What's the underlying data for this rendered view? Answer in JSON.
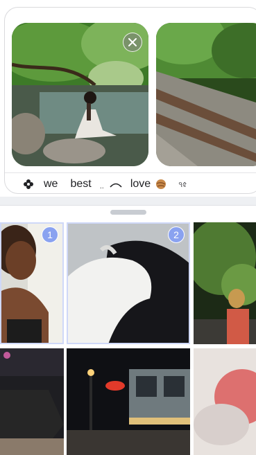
{
  "composer": {
    "attachments": [
      {
        "name": "meditating-by-river",
        "icon": "photo"
      },
      {
        "name": "railway-tracks",
        "icon": "photo"
      }
    ],
    "remove_icon": "close-icon",
    "suggestions": {
      "flower_icon": "flower-icon",
      "word_1": "we",
      "word_2": "best",
      "dots": "..",
      "arc_icon": "arc-icon",
      "word_3": "love",
      "emoji_icon": "planet-emoji-icon",
      "glyph": "ঀ৫"
    }
  },
  "picker": {
    "handle_icon": "drag-handle",
    "photos": [
      {
        "name": "selfie",
        "selected": true,
        "order": "1"
      },
      {
        "name": "horses",
        "selected": true,
        "order": "2"
      },
      {
        "name": "woman-in-trees",
        "selected": false
      },
      {
        "name": "night-street",
        "selected": false
      },
      {
        "name": "neon-sign-truck",
        "selected": false
      },
      {
        "name": "red-blur",
        "selected": false
      }
    ]
  },
  "colors": {
    "accent": "#8aa2f0",
    "card_border": "#d9d9dc",
    "separator": "#eef0f3"
  }
}
